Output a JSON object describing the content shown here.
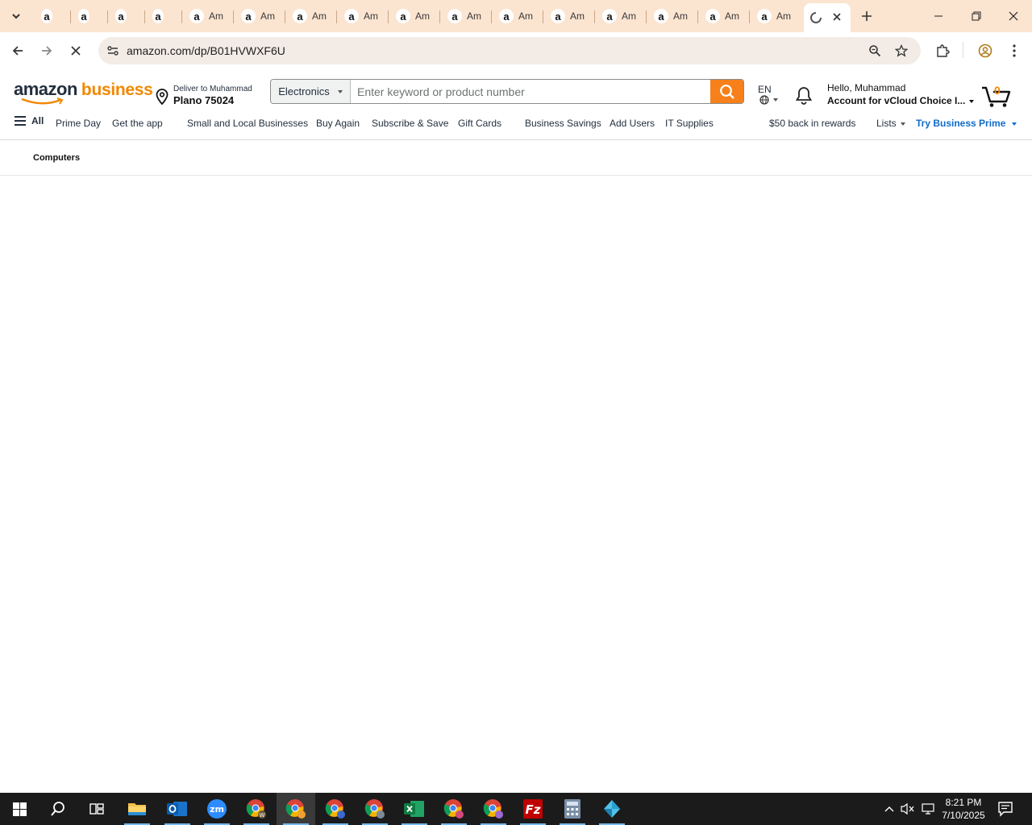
{
  "browser": {
    "tabs": [
      {
        "title": ""
      },
      {
        "title": ""
      },
      {
        "title": ""
      },
      {
        "title": ""
      },
      {
        "title": "Am"
      },
      {
        "title": "Am"
      },
      {
        "title": "Am"
      },
      {
        "title": "Am"
      },
      {
        "title": "Am"
      },
      {
        "title": "Am"
      },
      {
        "title": "Am"
      },
      {
        "title": "Am"
      },
      {
        "title": "Am"
      },
      {
        "title": "Am"
      },
      {
        "title": "Am"
      },
      {
        "title": "Am"
      }
    ],
    "url": "amazon.com/dp/B01HVWXF6U"
  },
  "header": {
    "logo_amazon": "amazon",
    "logo_business": "business",
    "deliver_line1": "Deliver to Muhammad",
    "deliver_line2": "Plano 75024",
    "search_category": "Electronics",
    "search_placeholder": "Enter keyword or product number",
    "language": "EN",
    "greeting": "Hello, Muhammad",
    "account": "Account for vCloud Choice I...",
    "cart_count": "0"
  },
  "nav": {
    "all": "All",
    "items": [
      "Prime Day",
      "Get the app",
      "Small and Local Businesses",
      "Buy Again",
      "Subscribe & Save",
      "Gift Cards",
      "Business Savings",
      "Add Users",
      "IT Supplies",
      "$50 back in rewards"
    ],
    "lists": "Lists",
    "try_prime": "Try Business Prime"
  },
  "subnav": {
    "category": "Computers"
  },
  "taskbar": {
    "time": "8:21 PM",
    "date": "7/10/2025"
  },
  "colors": {
    "tab_strip": "#fbe4d0",
    "search_button": "#f7801a",
    "logo_business": "#f08804",
    "prime_link": "#0f6bc9",
    "taskbar": "#1b1b1b"
  }
}
